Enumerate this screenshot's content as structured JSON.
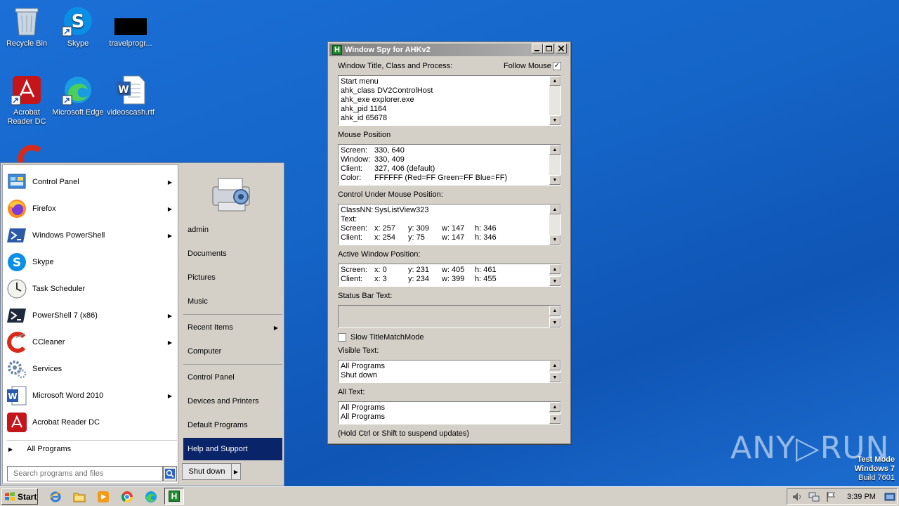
{
  "desktop": {
    "icons": [
      {
        "label": "Recycle Bin"
      },
      {
        "label": "Skype"
      },
      {
        "label": "travelprogr..."
      },
      {
        "label": "Acrobat Reader DC"
      },
      {
        "label": "Microsoft Edge"
      },
      {
        "label": "videoscash.rtf"
      }
    ]
  },
  "start_menu": {
    "programs": [
      {
        "label": "Control Panel",
        "has_submenu": true
      },
      {
        "label": "Firefox",
        "has_submenu": true
      },
      {
        "label": "Windows PowerShell",
        "has_submenu": true
      },
      {
        "label": "Skype",
        "has_submenu": false
      },
      {
        "label": "Task Scheduler",
        "has_submenu": false
      },
      {
        "label": "PowerShell 7 (x86)",
        "has_submenu": true
      },
      {
        "label": "CCleaner",
        "has_submenu": true
      },
      {
        "label": "Services",
        "has_submenu": false
      },
      {
        "label": "Microsoft Word 2010",
        "has_submenu": true
      },
      {
        "label": "Acrobat Reader DC",
        "has_submenu": false
      }
    ],
    "all_programs": "All Programs",
    "search_placeholder": "Search programs and files",
    "right": {
      "user": "admin",
      "documents": "Documents",
      "pictures": "Pictures",
      "music": "Music",
      "recent_items": "Recent Items",
      "computer": "Computer",
      "control_panel": "Control Panel",
      "devices": "Devices and Printers",
      "default_programs": "Default Programs",
      "help": "Help and Support"
    },
    "shutdown": "Shut down"
  },
  "spy": {
    "title": "Window Spy for AHKv2",
    "title_label": "Window Title, Class and Process:",
    "follow_mouse": "Follow Mouse",
    "follow_mouse_checked": true,
    "title_lines": [
      "Start menu",
      "ahk_class DV2ControlHost",
      "ahk_exe explorer.exe",
      "ahk_pid 1164",
      "ahk_id 65678"
    ],
    "mouse_label": "Mouse Position",
    "mouse": {
      "screen_k": "Screen:",
      "screen_v": "330, 640",
      "window_k": "Window:",
      "window_v": "330, 409",
      "client_k": "Client:",
      "client_v": "327, 406 (default)",
      "color_k": "Color:",
      "color_v": "FFFFFF (Red=FF Green=FF Blue=FF)"
    },
    "control_label": "Control Under Mouse Position:",
    "control": {
      "classnn_k": "ClassNN:",
      "classnn_v": "SysListView323",
      "text_k": "Text:",
      "screen": {
        "k": "Screen:",
        "x": "x: 257",
        "y": "y: 309",
        "w": "w: 147",
        "h": "h: 346"
      },
      "client": {
        "k": "Client:",
        "x": "x: 254",
        "y": "y: 75",
        "w": "w: 147",
        "h": "h: 346"
      }
    },
    "active_label": "Active Window Position:",
    "active": {
      "screen": {
        "k": "Screen:",
        "x": "x: 0",
        "y": "y: 231",
        "w": "w: 405",
        "h": "h: 461"
      },
      "client": {
        "k": "Client:",
        "x": "x: 3",
        "y": "y: 234",
        "w": "w: 399",
        "h": "h: 455"
      }
    },
    "statusbar_label": "Status Bar Text:",
    "slow_mode": "Slow TitleMatchMode",
    "visible_label": "Visible Text:",
    "visible_lines": [
      "All Programs",
      "Shut down"
    ],
    "alltext_label": "All Text:",
    "alltext_lines": [
      "All Programs",
      "All Programs"
    ],
    "hint": "(Hold Ctrl or Shift to suspend updates)"
  },
  "taskbar": {
    "start": "Start",
    "clock": "3:39 PM"
  },
  "watermark": "ANY▷RUN",
  "test_mode": {
    "line1": "Test Mode",
    "line2": "Windows 7",
    "line3": "Build 7601"
  }
}
